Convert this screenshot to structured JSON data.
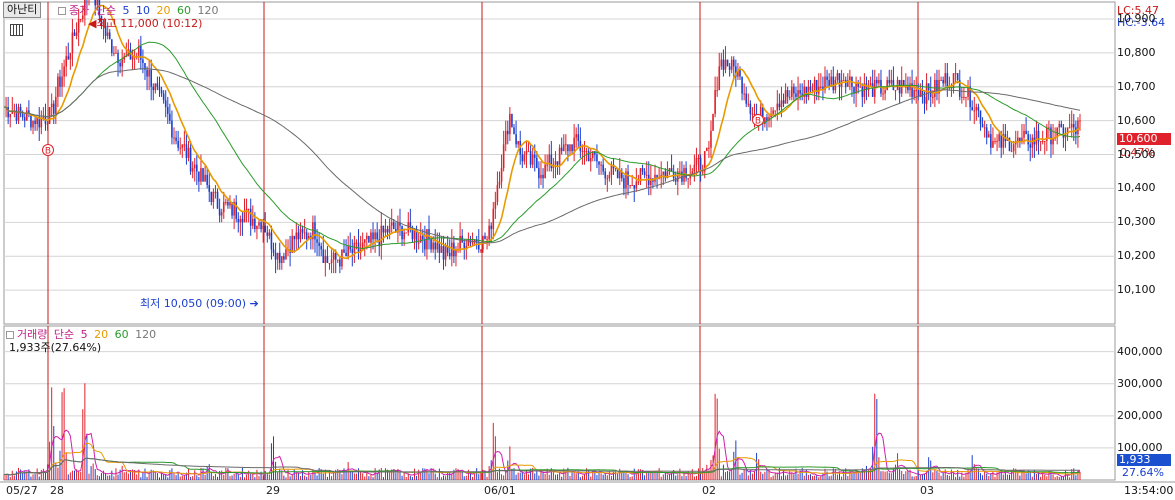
{
  "top_bar": {
    "tab_label": "아난티",
    "price_legend": {
      "prefix": "종가",
      "ma_prefix": "단순",
      "ma5": "5",
      "ma10": "10",
      "ma20": "20",
      "ma60": "60",
      "ma120": "120"
    },
    "lc_text": "LC:5.47",
    "hc_text": "HC:-3.64"
  },
  "volume_legend": {
    "prefix": "거래량",
    "ma_prefix": "단순",
    "ma5": "5",
    "ma20": "20",
    "ma60": "60",
    "ma120": "120"
  },
  "volume_info": "1,933주(27.64%)",
  "annotations": {
    "high": "최고 11,000 (10:12)",
    "low": "최저 10,050 (09:00)",
    "buy_marker": "B"
  },
  "price_tag": {
    "value": "10,600",
    "change": "0.47%"
  },
  "volume_tag": {
    "value": "1,933",
    "pct": "27.64%"
  },
  "time_label": "13:54:00",
  "x_labels": [
    "05/27",
    "28",
    "29",
    "06/01",
    "02",
    "03"
  ],
  "price_ticks": [
    "10,900",
    "10,800",
    "10,700",
    "10,600",
    "10,500",
    "10,400",
    "10,300",
    "10,200",
    "10,100"
  ],
  "volume_ticks": [
    "400,000",
    "300,000",
    "200,000",
    "100,000"
  ],
  "colors": {
    "up": "#e0202a",
    "down": "#1a3fcf",
    "ma5": "#e89a00",
    "ma20": "#2a9a2a",
    "ma120": "#6a6a6a",
    "session": "#c81818",
    "grid": "#d4d4d4",
    "vol_ma5": "#d020b0"
  },
  "chart_data": [
    {
      "type": "line",
      "title": "아난티",
      "ylim": [
        10000,
        10950
      ],
      "grid": true,
      "sessions": [
        "05/27",
        "28",
        "29",
        "06/01",
        "02",
        "03"
      ],
      "series": [
        {
          "name": "종가",
          "anchors": [
            [
              0,
              10640
            ],
            [
              0.03,
              10600
            ],
            [
              0.045,
              10620
            ],
            [
              0.05,
              10700
            ],
            [
              0.07,
              10900
            ],
            [
              0.08,
              11000
            ],
            [
              0.095,
              10850
            ],
            [
              0.11,
              10780
            ],
            [
              0.125,
              10800
            ],
            [
              0.14,
              10700
            ],
            [
              0.16,
              10550
            ],
            [
              0.18,
              10450
            ],
            [
              0.2,
              10350
            ],
            [
              0.22,
              10330
            ],
            [
              0.24,
              10300
            ],
            [
              0.255,
              10200
            ],
            [
              0.27,
              10250
            ],
            [
              0.29,
              10280
            ],
            [
              0.3,
              10180
            ],
            [
              0.315,
              10200
            ],
            [
              0.33,
              10220
            ],
            [
              0.36,
              10280
            ],
            [
              0.38,
              10270
            ],
            [
              0.4,
              10240
            ],
            [
              0.41,
              10200
            ],
            [
              0.43,
              10250
            ],
            [
              0.45,
              10250
            ],
            [
              0.455,
              10350
            ],
            [
              0.47,
              10620
            ],
            [
              0.48,
              10500
            ],
            [
              0.5,
              10450
            ],
            [
              0.53,
              10540
            ],
            [
              0.56,
              10450
            ],
            [
              0.58,
              10420
            ],
            [
              0.62,
              10450
            ],
            [
              0.64,
              10450
            ],
            [
              0.655,
              10500
            ],
            [
              0.665,
              10780
            ],
            [
              0.68,
              10750
            ],
            [
              0.7,
              10600
            ],
            [
              0.72,
              10660
            ],
            [
              0.74,
              10680
            ],
            [
              0.78,
              10730
            ],
            [
              0.8,
              10690
            ],
            [
              0.84,
              10700
            ],
            [
              0.86,
              10680
            ],
            [
              0.88,
              10730
            ],
            [
              0.9,
              10660
            ],
            [
              0.92,
              10530
            ],
            [
              0.95,
              10540
            ],
            [
              1.0,
              10580
            ]
          ]
        },
        {
          "name": "5"
        },
        {
          "name": "20"
        },
        {
          "name": "120"
        }
      ]
    },
    {
      "type": "bar",
      "title": "거래량",
      "ylim": [
        0,
        480000
      ],
      "grid": true,
      "peaks": [
        [
          0.045,
          360000
        ],
        [
          0.055,
          380000
        ],
        [
          0.075,
          400000
        ],
        [
          0.11,
          60000
        ],
        [
          0.19,
          80000
        ],
        [
          0.25,
          180000
        ],
        [
          0.32,
          75000
        ],
        [
          0.39,
          80000
        ],
        [
          0.455,
          250000
        ],
        [
          0.47,
          120000
        ],
        [
          0.662,
          400000
        ],
        [
          0.68,
          220000
        ],
        [
          0.7,
          130000
        ],
        [
          0.81,
          380000
        ],
        [
          0.83,
          100000
        ],
        [
          0.86,
          130000
        ],
        [
          0.9,
          90000
        ]
      ],
      "last_value": 1933
    }
  ]
}
